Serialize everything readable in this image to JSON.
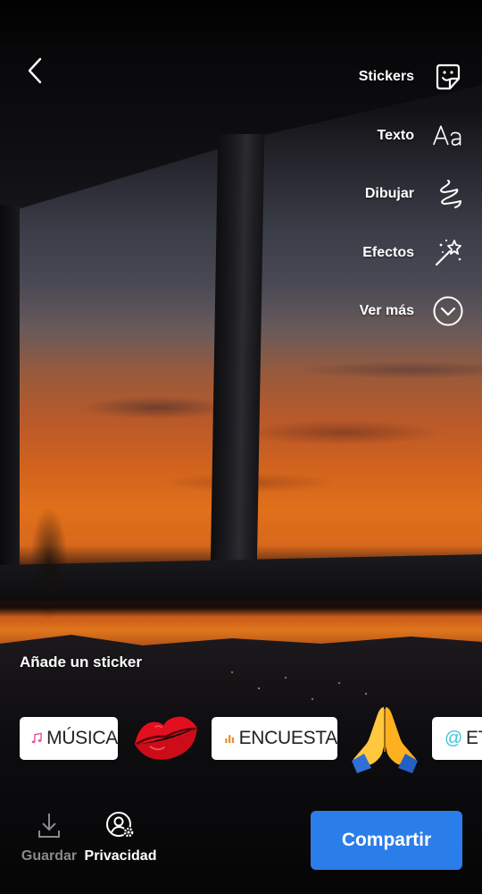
{
  "header": {
    "back_icon": "chevron-left-icon"
  },
  "tools": [
    {
      "label": "Stickers",
      "icon": "sticker-icon"
    },
    {
      "label": "Texto",
      "icon": "text-aa-icon"
    },
    {
      "label": "Dibujar",
      "icon": "squiggle-draw-icon"
    },
    {
      "label": "Efectos",
      "icon": "magic-wand-icon"
    },
    {
      "label": "Ver más",
      "icon": "chevron-down-circle-icon"
    }
  ],
  "sticker_hint": "Añade un sticker",
  "stickers": {
    "music_label": "MÚSICA",
    "poll_label": "ENCUESTA",
    "mention_label": "ET",
    "lips_icon": "kiss-lips-icon",
    "hands_icon": "praying-hands-icon"
  },
  "bottom": {
    "save_label": "Guardar",
    "privacy_label": "Privacidad",
    "share_label": "Compartir"
  },
  "colors": {
    "share_button": "#2b7de9",
    "music_accent": "#e0559b",
    "poll_accent": "#f0882a",
    "mention_accent": "#3cc6d6",
    "disabled_text": "#8a8a8c"
  }
}
